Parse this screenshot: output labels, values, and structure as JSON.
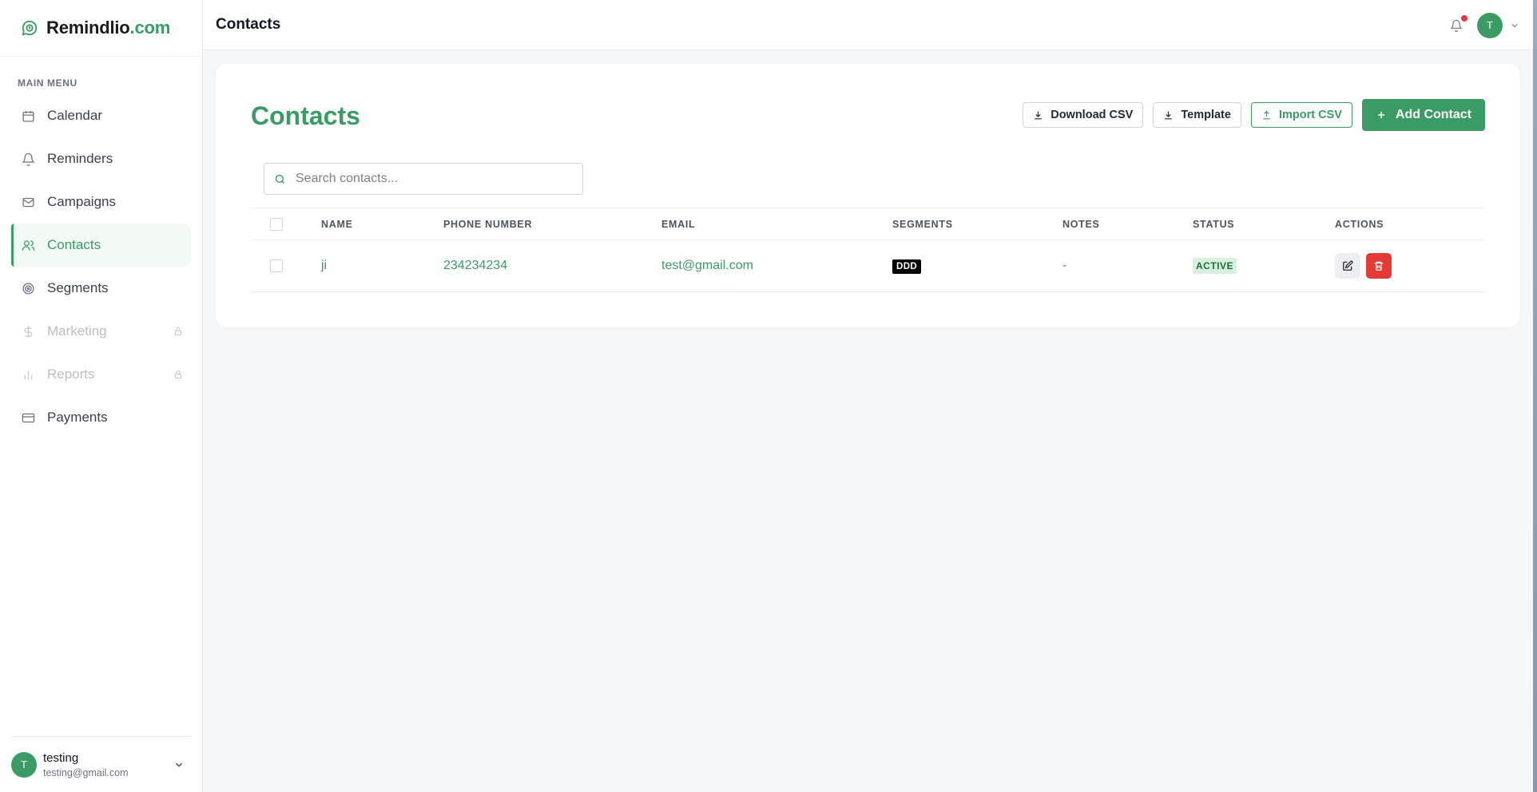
{
  "brand": {
    "name": "Remindlio",
    "tld": ".com"
  },
  "sidebar": {
    "heading": "MAIN MENU",
    "items": [
      {
        "label": "Calendar",
        "icon": "calendar-icon",
        "active": false,
        "locked": false
      },
      {
        "label": "Reminders",
        "icon": "bell-icon",
        "active": false,
        "locked": false
      },
      {
        "label": "Campaigns",
        "icon": "mail-icon",
        "active": false,
        "locked": false
      },
      {
        "label": "Contacts",
        "icon": "users-icon",
        "active": true,
        "locked": false
      },
      {
        "label": "Segments",
        "icon": "target-icon",
        "active": false,
        "locked": false
      },
      {
        "label": "Marketing",
        "icon": "dollar-icon",
        "active": false,
        "locked": true
      },
      {
        "label": "Reports",
        "icon": "bar-chart-icon",
        "active": false,
        "locked": true
      },
      {
        "label": "Payments",
        "icon": "credit-card-icon",
        "active": false,
        "locked": false
      }
    ],
    "user": {
      "initial": "T",
      "name": "testing",
      "email": "testing@gmail.com"
    }
  },
  "topbar": {
    "title": "Contacts",
    "avatar_initial": "T",
    "has_notification": true
  },
  "main": {
    "title": "Contacts",
    "buttons": {
      "download_csv": "Download CSV",
      "template": "Template",
      "import_csv": "Import CSV",
      "add_contact": "Add Contact"
    },
    "search": {
      "placeholder": "Search contacts...",
      "value": ""
    },
    "table": {
      "columns": [
        "NAME",
        "PHONE NUMBER",
        "EMAIL",
        "SEGMENTS",
        "NOTES",
        "STATUS",
        "ACTIONS"
      ],
      "rows": [
        {
          "name": "ji",
          "phone": "234234234",
          "email": "test@gmail.com",
          "segment": "DDD",
          "notes": "-",
          "status": "ACTIVE"
        }
      ]
    }
  },
  "colors": {
    "brand_green": "#3a9b64",
    "danger": "#e53935",
    "status_bg": "#d8f1df"
  }
}
